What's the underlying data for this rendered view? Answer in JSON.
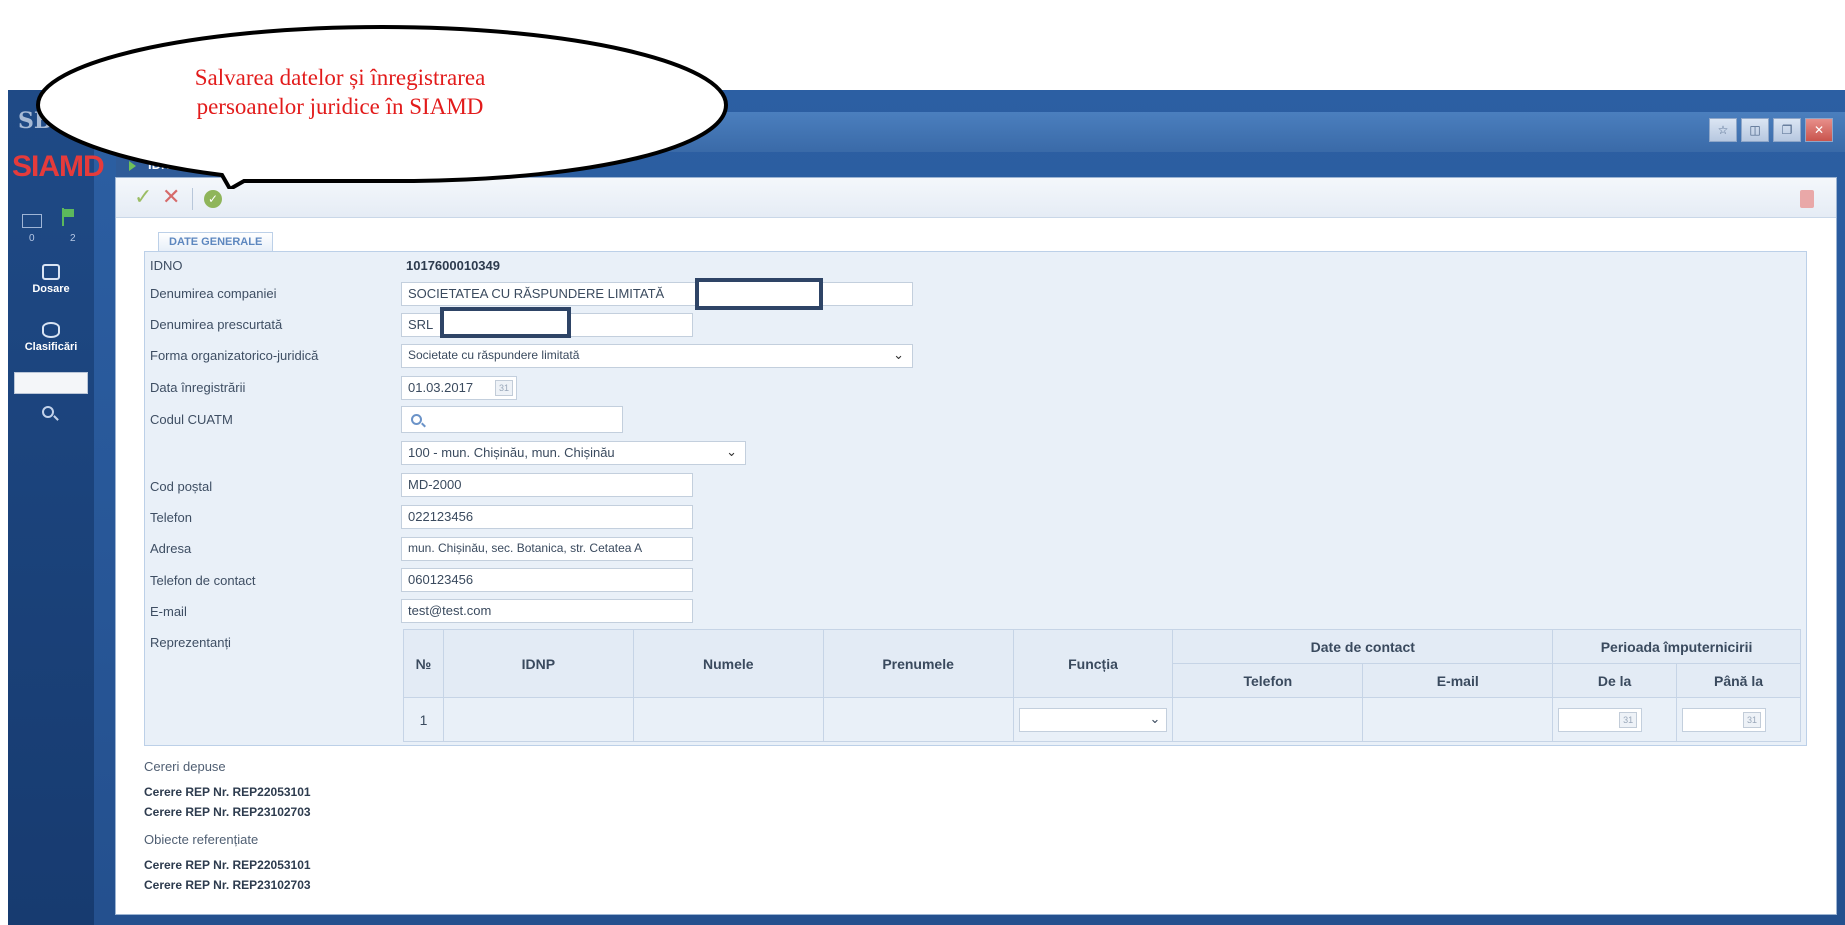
{
  "callout": {
    "line1": "Salvarea datelor și înregistrarea",
    "line2": "persoanelor juridice în SIAMD"
  },
  "sidebar": {
    "logo_small": "SB",
    "logo_main": "SIAMD",
    "mail_count": "0",
    "flag_count": "2",
    "items": [
      {
        "label": "Dosare",
        "icon": "folder-icon"
      },
      {
        "label": "Clasificări",
        "icon": "database-icon"
      }
    ],
    "search_icon": "search-icon"
  },
  "window": {
    "tab_title": "IDNO1",
    "buttons": [
      "star-icon",
      "tile-icon",
      "restore-icon",
      "close-icon"
    ]
  },
  "toolbar": {
    "save_icon": "checkmark-icon",
    "cancel_icon": "x-icon",
    "confirm_icon": "confirm-circle-icon",
    "delete_icon": "trash-icon"
  },
  "section": {
    "title": "DATE GENERALE"
  },
  "form": {
    "idno_label": "IDNO",
    "idno_value": "1017600010349",
    "company_label": "Denumirea companiei",
    "company_value": "SOCIETATEA CU RĂSPUNDERE LIMITATĂ",
    "short_label": "Denumirea prescurtată",
    "short_value": "SRL",
    "legal_form_label": "Forma organizatorico-juridică",
    "legal_form_value": "Societate cu răspundere limitată",
    "reg_date_label": "Data înregistrării",
    "reg_date_value": "01.03.2017",
    "cuatm_label": "Codul CUATM",
    "cuatm_search_value": "",
    "cuatm_select_value": "100 - mun. Chișinău, mun. Chișinău",
    "postal_label": "Cod poștal",
    "postal_value": "MD-2000",
    "phone_label": "Telefon",
    "phone_value": "022123456",
    "address_label": "Adresa",
    "address_value": "mun. Chișinău, sec. Botanica, str. Cetatea A",
    "contact_phone_label": "Telefon de contact",
    "contact_phone_value": "060123456",
    "email_label": "E-mail",
    "email_value": "test@test.com",
    "reps_label": "Reprezentanți"
  },
  "reps_table": {
    "headers": {
      "nr": "№",
      "idnp": "IDNP",
      "last_name": "Numele",
      "first_name": "Prenumele",
      "function": "Funcția",
      "contact_group": "Date de contact",
      "phone": "Telefon",
      "email": "E-mail",
      "period_group": "Perioada împuternicirii",
      "from": "De la",
      "to": "Până la"
    },
    "rows": [
      {
        "nr": "1",
        "idnp": "",
        "last_name": "",
        "first_name": "",
        "function": "",
        "phone": "",
        "email": "",
        "from": "",
        "to": ""
      }
    ]
  },
  "requests": {
    "submitted_label": "Cereri depuse",
    "submitted": [
      "Cerere REP Nr. REP22053101",
      "Cerere REP Nr. REP23102703"
    ],
    "referenced_label": "Obiecte referențiate",
    "referenced": [
      "Cerere REP Nr. REP22053101",
      "Cerere REP Nr. REP23102703"
    ]
  }
}
